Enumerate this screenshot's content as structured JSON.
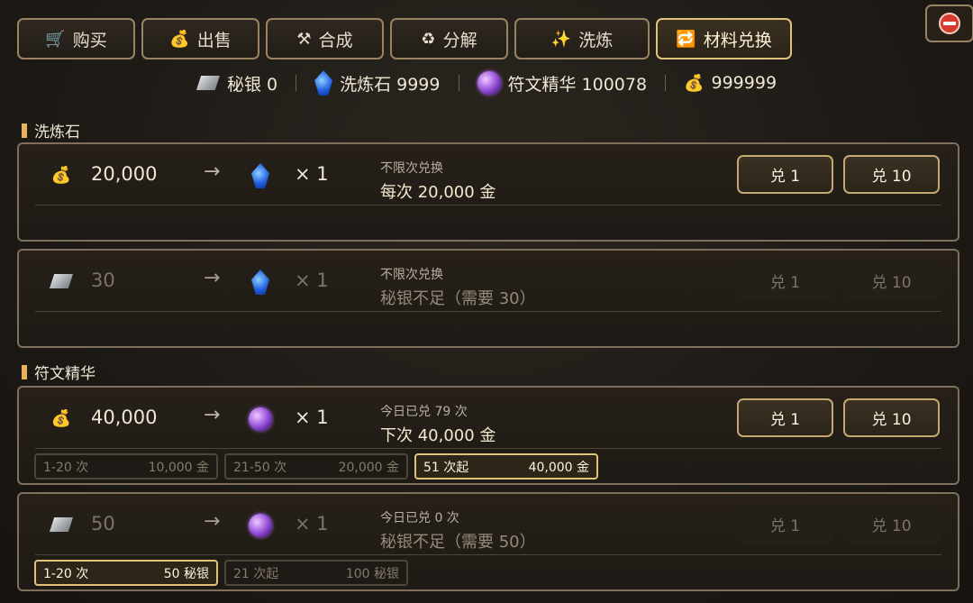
{
  "tabs": [
    {
      "icon": "🛒",
      "label": "购买",
      "active": false
    },
    {
      "icon": "💰",
      "label": "出售",
      "active": false
    },
    {
      "icon": "⚒",
      "label": "合成",
      "active": false
    },
    {
      "icon": "♻",
      "label": "分解",
      "active": false
    },
    {
      "icon": "✨",
      "label": "洗炼",
      "active": false
    },
    {
      "icon": "🔁",
      "label": "材料兑换",
      "active": true
    }
  ],
  "resources": [
    {
      "icon": "silver-ingot-icon",
      "label": "秘银 0"
    },
    {
      "icon": "refine-stone-icon",
      "label": "洗炼石 9999"
    },
    {
      "icon": "rune-essence-icon",
      "label": "符文精华 100078"
    },
    {
      "icon": "gold-bag-icon",
      "label": "999999"
    }
  ],
  "sections": {
    "refine": "洗炼石",
    "rune": "符文精华"
  },
  "cards": [
    {
      "cost_icon": "gold-bag-icon",
      "cost": "20,000",
      "arrow": "→",
      "out_icon": "refine-stone-icon",
      "mult": "× 1",
      "line1": "不限次兑换",
      "line2": "每次 20,000 金",
      "btn1": "兑 1",
      "btn10": "兑 10",
      "disabled": false
    },
    {
      "cost_icon": "silver-ingot-icon",
      "cost": "30",
      "arrow": "→",
      "out_icon": "refine-stone-icon",
      "mult": "× 1",
      "line1": "不限次兑换",
      "line2": "秘银不足（需要 30）",
      "btn1": "兑 1",
      "btn10": "兑 10",
      "disabled": true
    },
    {
      "cost_icon": "gold-bag-icon",
      "cost": "40,000",
      "arrow": "→",
      "out_icon": "rune-essence-icon",
      "mult": "× 1",
      "line1": "今日已兑 79 次",
      "line2": "下次 40,000 金",
      "btn1": "兑 1",
      "btn10": "兑 10",
      "disabled": false,
      "tiers": [
        {
          "range": "1-20 次",
          "price": "10,000 金",
          "active": false
        },
        {
          "range": "21-50 次",
          "price": "20,000 金",
          "active": false
        },
        {
          "range": "51 次起",
          "price": "40,000 金",
          "active": true
        }
      ]
    },
    {
      "cost_icon": "silver-ingot-icon",
      "cost": "50",
      "arrow": "→",
      "out_icon": "rune-essence-icon",
      "mult": "× 1",
      "line1": "今日已兑 0 次",
      "line2": "秘银不足（需要 50）",
      "btn1": "兑 1",
      "btn10": "兑 10",
      "disabled": true,
      "tiers": [
        {
          "range": "1-20 次",
          "price": "50 秘银",
          "active": true
        },
        {
          "range": "21 次起",
          "price": "100 秘银",
          "active": false
        }
      ]
    }
  ]
}
